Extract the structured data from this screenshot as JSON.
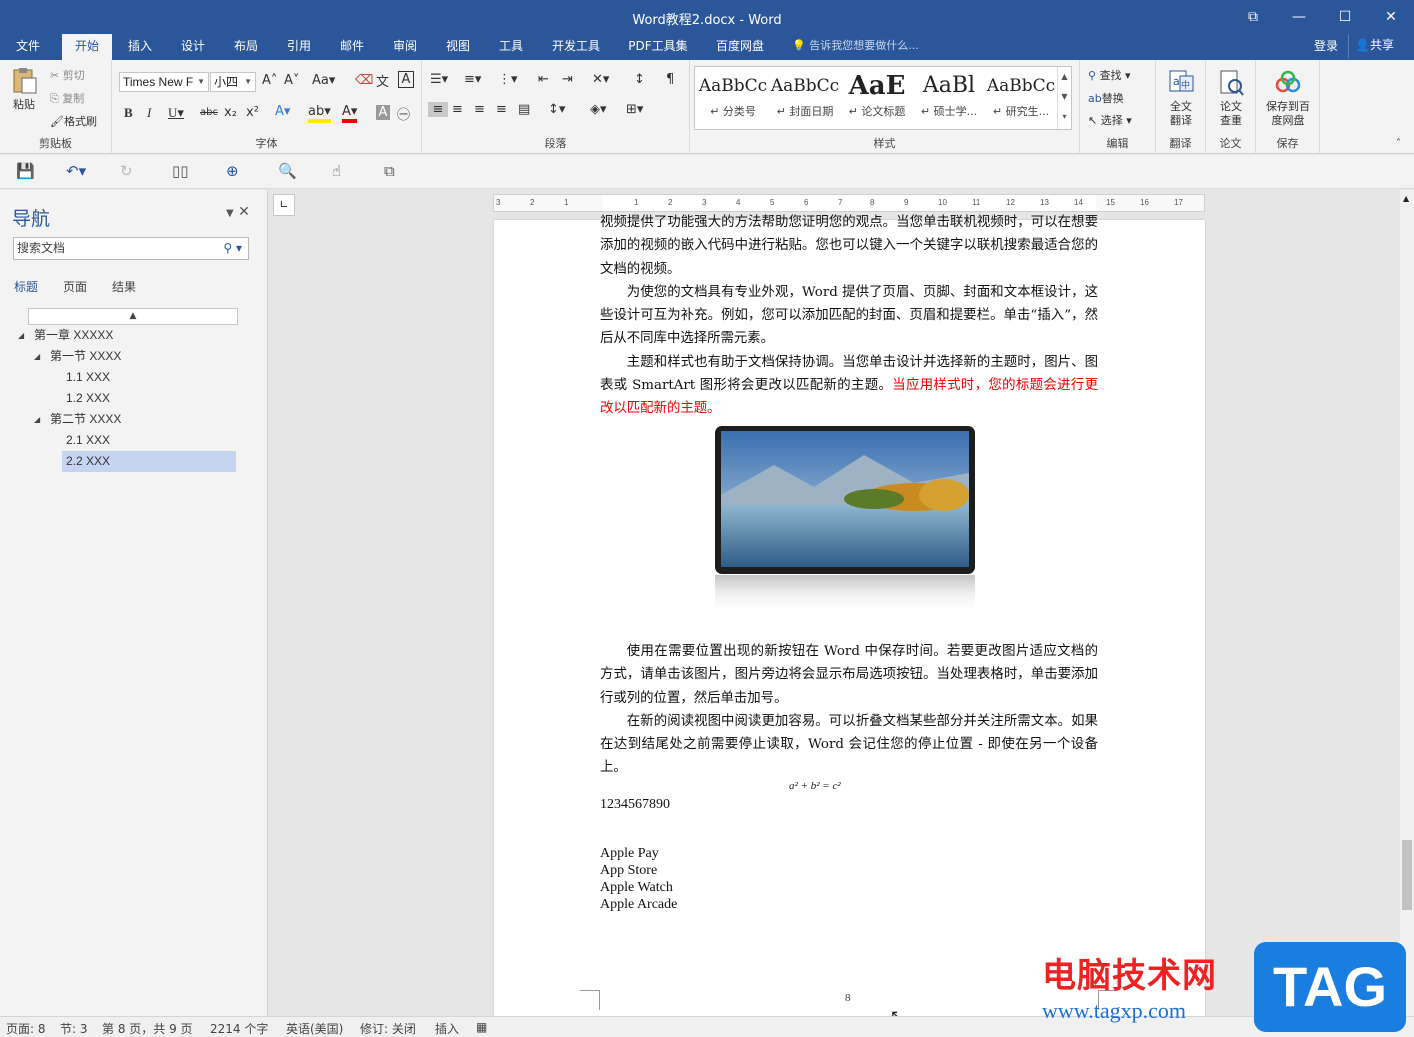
{
  "window": {
    "title": "Word教程2.docx - Word",
    "controls": [
      "restore-ribbon",
      "minimize",
      "maximize",
      "close"
    ]
  },
  "ribbon_tabs": [
    {
      "label": "文件",
      "active": false
    },
    {
      "label": "开始",
      "active": true
    },
    {
      "label": "插入",
      "active": false
    },
    {
      "label": "设计",
      "active": false
    },
    {
      "label": "布局",
      "active": false
    },
    {
      "label": "引用",
      "active": false
    },
    {
      "label": "邮件",
      "active": false
    },
    {
      "label": "审阅",
      "active": false
    },
    {
      "label": "视图",
      "active": false
    },
    {
      "label": "工具",
      "active": false
    },
    {
      "label": "开发工具",
      "active": false
    },
    {
      "label": "PDF工具集",
      "active": false
    },
    {
      "label": "百度网盘",
      "active": false
    }
  ],
  "tell_me": "告诉我您想要做什么...",
  "account": {
    "login": "登录",
    "share": "共享"
  },
  "clipboard": {
    "paste": "粘贴",
    "cut": "剪切",
    "copy": "复制",
    "format_painter": "格式刷",
    "label": "剪贴板"
  },
  "font": {
    "name": "Times New F",
    "size": "小四",
    "label": "字体",
    "change_case": "Aa",
    "char_border": "A"
  },
  "paragraph": {
    "label": "段落"
  },
  "styles": {
    "label": "样式",
    "items": [
      {
        "sample": "AaBbCc",
        "name": "↵ 分类号"
      },
      {
        "sample": "AaBbCc",
        "name": "↵ 封面日期"
      },
      {
        "sample": "AaE",
        "name": "↵ 论文标题"
      },
      {
        "sample": "AaBl",
        "name": "↵ 硕士学..."
      },
      {
        "sample": "AaBbCc",
        "name": "↵ 研究生..."
      }
    ]
  },
  "editing": {
    "find": "查找",
    "replace": "替换",
    "select": "选择",
    "label": "编辑"
  },
  "translate": {
    "button": "全文翻译",
    "label": "翻译"
  },
  "thesis": {
    "button": "论文查重",
    "label": "论文"
  },
  "save_group": {
    "button": "保存到百度网盘",
    "label": "保存"
  },
  "navigation": {
    "title": "导航",
    "search_placeholder": "搜索文档",
    "tabs": [
      "标题",
      "页面",
      "结果"
    ],
    "active_tab": "标题",
    "tree": [
      {
        "label": "第一章 XXXXX",
        "level": 0,
        "expanded": true
      },
      {
        "label": "第一节 XXXX",
        "level": 1,
        "expanded": true
      },
      {
        "label": "1.1 XXX",
        "level": 2
      },
      {
        "label": "1.2 XXX",
        "level": 2
      },
      {
        "label": "第二节 XXXX",
        "level": 1,
        "expanded": true
      },
      {
        "label": "2.1 XXX",
        "level": 2
      },
      {
        "label": "2.2 XXX",
        "level": 2,
        "selected": true
      }
    ]
  },
  "ruler_ticks": [
    "3",
    "2",
    "1",
    "1",
    "2",
    "3",
    "4",
    "5",
    "6",
    "7",
    "8",
    "9",
    "10",
    "11",
    "12",
    "13",
    "14",
    "15",
    "16",
    "17"
  ],
  "document": {
    "p0_tail": "视频提供了功能强大的方法帮助您证明您的观点。当您单击联机视频时，可以在想要添加的视频的嵌入代码中进行粘贴。您也可以键入一个关键字以联机搜索最适合您的文档的视频。",
    "p1": "为使您的文档具有专业外观，Word 提供了页眉、页脚、封面和文本框设计，这些设计可互为补充。例如，您可以添加匹配的封面、页眉和提要栏。单击“插入”，然后从不同库中选择所需元素。",
    "p2_black": "主题和样式也有助于文档保持协调。当您单击设计并选择新的主题时，图片、图表或 SmartArt 图形将会更改以匹配新的主题。",
    "p2_red": "当应用样式时，您的标题会进行更改以匹配新的主题。",
    "p3": "使用在需要位置出现的新按钮在 Word 中保存时间。若要更改图片适应文档的方式，请单击该图片，图片旁边将会显示布局选项按钮。当处理表格时，单击要添加行或列的位置，然后单击加号。",
    "p4": "在新的阅读视图中阅读更加容易。可以折叠文档某些部分并关注所需文本。如果在达到结尾处之前需要停止读取，Word 会记住您的停止位置 - 即使在另一个设备上。",
    "equation": "a² + b² = c²",
    "number_line": "1234567890",
    "list": [
      "Apple Pay",
      "App Store",
      "Apple Watch",
      "Apple Arcade"
    ],
    "page_number": "8"
  },
  "status": {
    "page": "页面: 8",
    "section": "节: 3",
    "page_of": "第 8 页，共 9 页",
    "words": "2214 个字",
    "language": "英语(美国)",
    "track_changes": "修订: 关闭",
    "insert_mode": "插入"
  },
  "watermark": {
    "cn": "电脑技术网",
    "url": "www.tagxp.com",
    "tag": "TAG"
  },
  "colors": {
    "accent": "#2b579a",
    "selected": "#c5d5f0",
    "red_text": "#ee0000"
  }
}
